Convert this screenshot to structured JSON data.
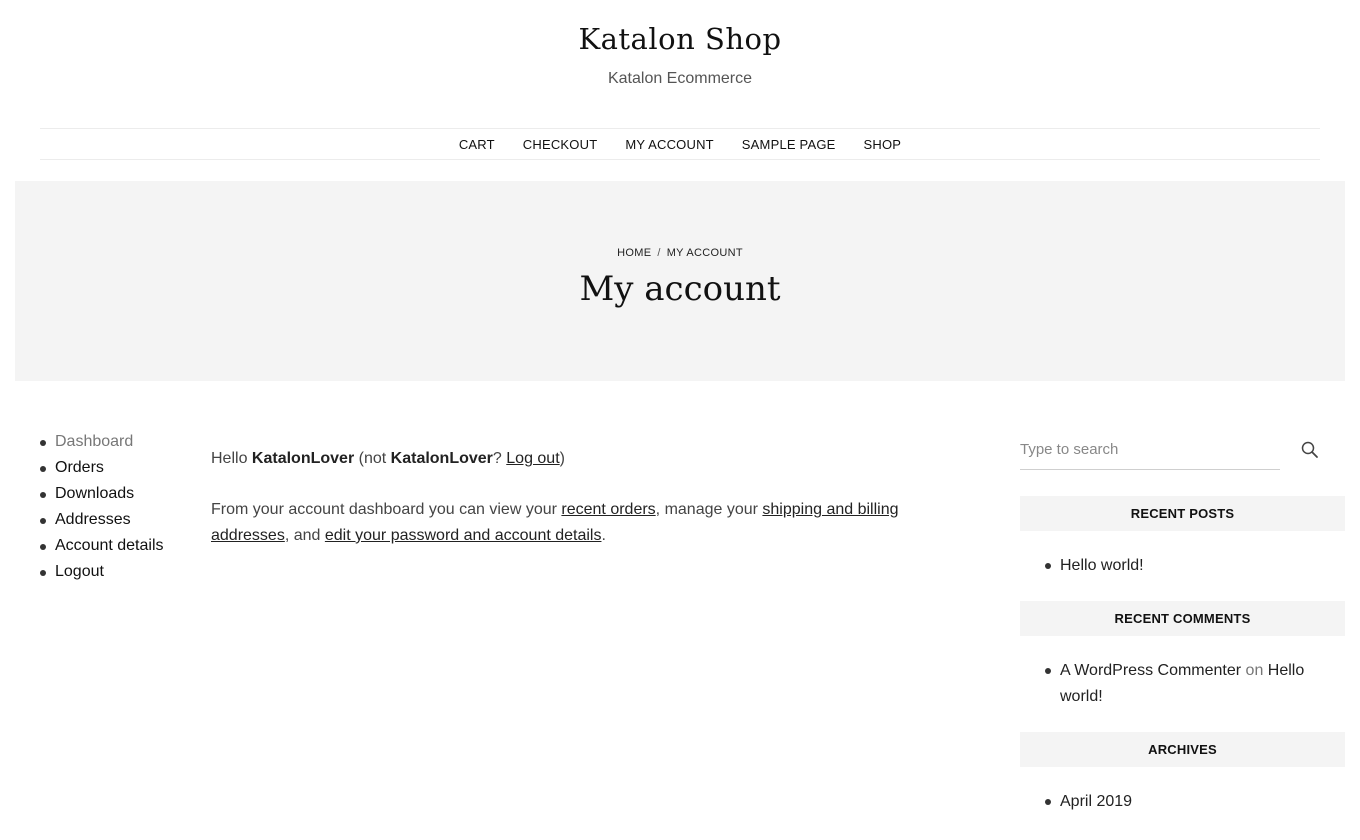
{
  "site": {
    "title": "Katalon Shop",
    "description": "Katalon Ecommerce"
  },
  "nav": {
    "items": [
      "CART",
      "CHECKOUT",
      "MY ACCOUNT",
      "SAMPLE PAGE",
      "SHOP"
    ]
  },
  "hero": {
    "breadcrumb_home": "HOME",
    "breadcrumb_sep": "/",
    "breadcrumb_current": "MY ACCOUNT",
    "title": "My account"
  },
  "account_nav": {
    "items": [
      "Dashboard",
      "Orders",
      "Downloads",
      "Addresses",
      "Account details",
      "Logout"
    ],
    "active": "Dashboard"
  },
  "content": {
    "hello": "Hello",
    "user": "KatalonLover",
    "not_open": "(not",
    "not_user": "KatalonLover",
    "question": "?",
    "logout_link": "Log out",
    "close_paren": ")",
    "dash_intro": "From your account dashboard you can view your",
    "recent_orders_link": "recent orders",
    "manage": ", manage your",
    "addresses_link": "shipping and billing addresses",
    "and": ", and",
    "password_link": "edit your password and account details",
    "period": "."
  },
  "sidebar": {
    "search_placeholder": "Type to search",
    "recent_posts_title": "RECENT POSTS",
    "recent_posts": [
      "Hello world!"
    ],
    "recent_comments_title": "RECENT COMMENTS",
    "comment_author": "A WordPress Commenter",
    "comment_on": "on",
    "comment_post": "Hello world!",
    "archives_title": "ARCHIVES",
    "archives": [
      "April 2019"
    ]
  },
  "icons": {
    "search": "search-icon"
  }
}
